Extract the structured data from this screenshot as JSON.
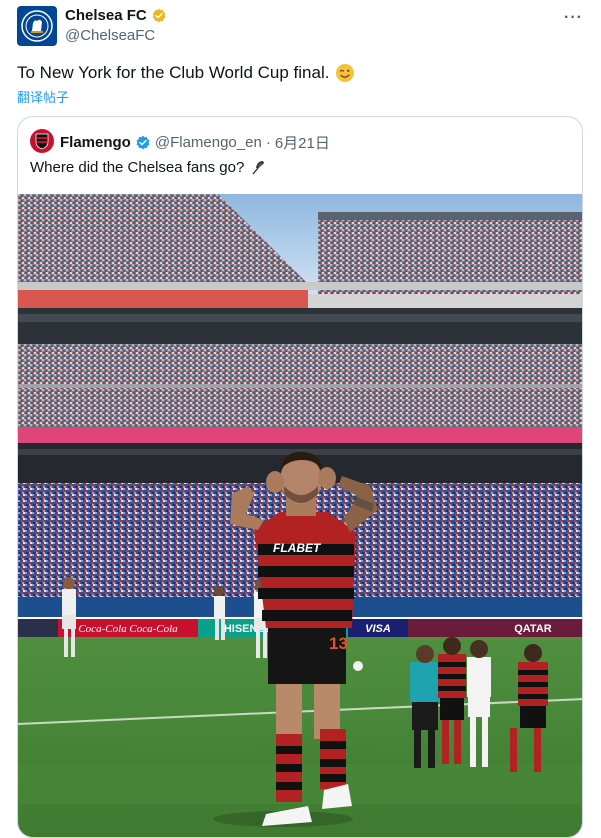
{
  "author": {
    "name": "Chelsea FC",
    "handle": "@ChelseaFC",
    "verified_color": "#e8b820"
  },
  "tweet": {
    "text": "To New York for the Club World Cup final.",
    "emoji": "wink-emoji-icon",
    "translate_label": "翻译帖子"
  },
  "quoted": {
    "name": "Flamengo",
    "handle": "@Flamengo_en",
    "separator": "·",
    "date": "6月21日",
    "text": "Where did the Chelsea fans go?",
    "emoji": "feather-icon",
    "verified_color": "#1d9bf0"
  },
  "photo": {
    "description_icon": "stadium-photo",
    "shirt_sponsor": "FLABET",
    "shirt_number": "13",
    "ad_boards": [
      "Coca-Cola",
      "Coca-Cola",
      "HISENSE",
      "VISA",
      "QATAR"
    ]
  },
  "colors": {
    "accent": "#1d9bf0",
    "chelsea_blue": "#034694",
    "flamengo_red": "#c8102e"
  }
}
